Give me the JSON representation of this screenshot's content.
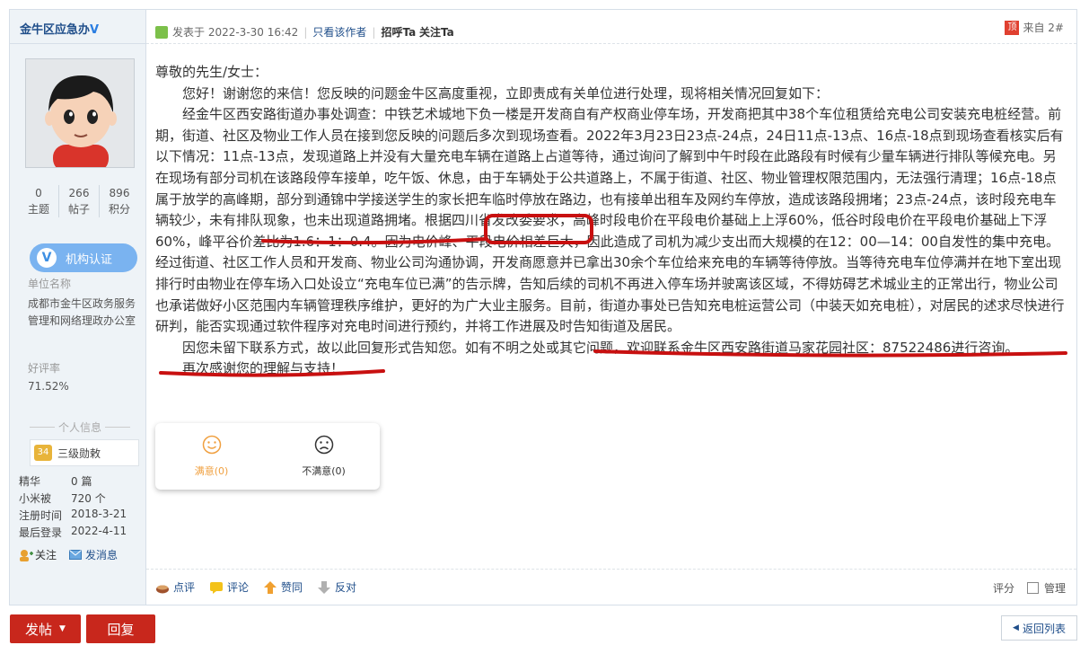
{
  "user": {
    "name": "金牛区应急办",
    "v_badge": "V",
    "stats": [
      {
        "value": "0",
        "label": "主题"
      },
      {
        "value": "266",
        "label": "帖子"
      },
      {
        "value": "896",
        "label": "积分"
      }
    ],
    "verify_label": "机构认证",
    "verify_icon_glyph": "V",
    "unit_label": "单位名称",
    "unit_value": "成都市金牛区政务服务管理和网络理政办公室",
    "rating_label": "好评率",
    "rating_value": "71.52%",
    "section_title": "个人信息",
    "level_icon": "34",
    "level_label": "三级勋敕",
    "info": [
      {
        "k": "精华",
        "v": "0 篇"
      },
      {
        "k": "小米被",
        "v": "720 个"
      },
      {
        "k": "注册时间",
        "v": "2018-3-21"
      },
      {
        "k": "最后登录",
        "v": "2022-4-11"
      }
    ],
    "follow_label": "关注",
    "message_label": "发消息"
  },
  "post": {
    "posted_at": "发表于 2022-3-30 16:42",
    "only_author": "只看该作者",
    "greet": "招呼Ta",
    "follow": "关注Ta",
    "floor_tag": "顶",
    "floor": "来自 2#",
    "paragraphs": [
      "尊敬的先生/女士：",
      "您好！谢谢您的来信！您反映的问题金牛区高度重视，立即责成有关单位进行处理，现将相关情况回复如下：",
      "经金牛区西安路街道办事处调查：中铁艺术城地下负一楼是开发商自有产权商业停车场，开发商把其中38个车位租赁给充电公司安装充电桩经营。前期，街道、社区及物业工作人员在接到您反映的问题后多次到现场查看。2022年3月23日23点-24点，24日11点-13点、16点-18点到现场查看核实后有以下情况：11点-13点，发现道路上并没有大量充电车辆在道路上占道等待，通过询问了解到中午时段在此路段有时候有少量车辆进行排队等候充电。另在现场有部分司机在该路段停车接单，吃午饭、休息，由于车辆处于公共道路上，不属于街道、社区、物业管理权限范围内，无法强行清理；16点-18点属于放学的高峰期，部分到通锦中学接送学生的家长把车临时停放在路边，也有接单出租车及网约车停放，造成该路段拥堵；23点-24点，该时段充电车辆较少，未有排队现象，也未出现道路拥堵。根据四川省发改委要求，高峰时段电价在平段电价基础上上浮60%，低谷时段电价在平段电价基础上下浮60%，峰平谷价差比为1.6：1：0.4。因为电价峰、平段电价相差巨大，因此造成了司机为减少支出而大规模的在12：00—14：00自发性的集中充电。经过街道、社区工作人员和开发商、物业公司沟通协调，开发商愿意并已拿出30余个车位给来充电的车辆等待停放。当等待充电车位停满并在地下室出现排行时由物业在停车场入口处设立“充电车位已满”的告示牌，告知后续的司机不再进入停车场并驶离该区域，不得妨碍艺术城业主的正常出行，物业公司也承诺做好小区范围内车辆管理秩序维护，更好的为广大业主服务。目前，街道办事处已告知充电桩运营公司（中装天如充电桩），对居民的述求尽快进行研判，能否实现通过软件程序对充电时间进行预约，并将工作进展及时告知街道及居民。",
      "因您未留下联系方式，故以此回复形式告知您。如有不明之处或其它问题，欢迎联系金牛区西安路街道马家花园社区：87522486进行咨询。",
      "再次感谢您的理解与支持！"
    ],
    "rating": [
      {
        "label": "满意(0)",
        "icon": "smile-icon",
        "color": "#f0a040"
      },
      {
        "label": "不满意(0)",
        "icon": "frown-icon",
        "color": "#333333"
      }
    ],
    "actions": [
      "点评",
      "评论",
      "赞同",
      "反对"
    ],
    "score_label": "评分",
    "manage_label": "管理"
  },
  "footer": {
    "post_button": "发帖",
    "reply_button": "回复",
    "back_button": "返回列表"
  },
  "colors": {
    "accent_red": "#c8271c",
    "link_blue": "#1f4e8a",
    "sidebar_bg": "#eef3f7"
  }
}
